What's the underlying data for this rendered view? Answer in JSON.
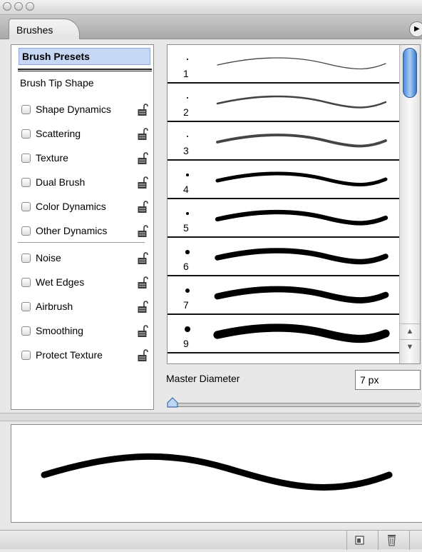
{
  "window": {
    "title": ""
  },
  "tabs": [
    {
      "label": "Brushes"
    }
  ],
  "options": {
    "presets_label": "Brush Presets",
    "tip_shape_label": "Brush Tip Shape",
    "items": [
      {
        "label": "Shape Dynamics",
        "checked": false
      },
      {
        "label": "Scattering",
        "checked": false
      },
      {
        "label": "Texture",
        "checked": false
      },
      {
        "label": "Dual Brush",
        "checked": false
      },
      {
        "label": "Color Dynamics",
        "checked": false
      },
      {
        "label": "Other Dynamics",
        "checked": false
      },
      {
        "label": "Noise",
        "checked": false
      },
      {
        "label": "Wet Edges",
        "checked": false
      },
      {
        "label": "Airbrush",
        "checked": false
      },
      {
        "label": "Smoothing",
        "checked": false
      },
      {
        "label": "Protect Texture",
        "checked": false
      }
    ]
  },
  "brushes": [
    {
      "size": "1"
    },
    {
      "size": "2"
    },
    {
      "size": "3"
    },
    {
      "size": "4"
    },
    {
      "size": "5"
    },
    {
      "size": "6"
    },
    {
      "size": "7"
    },
    {
      "size": "9"
    }
  ],
  "master_diameter": {
    "label": "Master Diameter",
    "value": "7 px"
  },
  "icons": {
    "lock": "lock-icon",
    "new_brush": "new-brush-icon",
    "trash": "trash-icon",
    "panel_menu": "panel-menu-icon"
  },
  "colors": {
    "selection": "#c6d8f5",
    "scroll_thumb": "#4a86d6"
  }
}
